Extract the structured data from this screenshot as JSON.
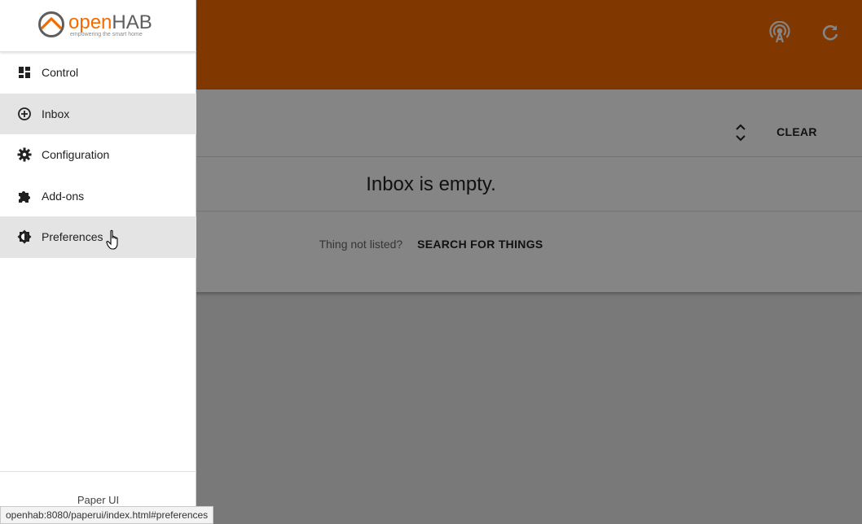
{
  "app": {
    "logo_name_open": "open",
    "logo_name_hab": "HAB",
    "logo_tagline": "empowering the smart home",
    "icons": [
      "antenna-icon",
      "refresh-icon"
    ]
  },
  "drawer": {
    "items": [
      {
        "label": "Control",
        "icon": "dashboard-icon"
      },
      {
        "label": "Inbox",
        "icon": "add-circle-icon"
      },
      {
        "label": "Configuration",
        "icon": "gear-icon"
      },
      {
        "label": "Add-ons",
        "icon": "puzzle-icon"
      },
      {
        "label": "Preferences",
        "icon": "brightness-icon"
      }
    ],
    "footer": "Paper UI"
  },
  "inbox": {
    "clear_label": "CLEAR",
    "empty_message": "Inbox is empty.",
    "hint": "Thing not listed?",
    "search_label": "SEARCH FOR THINGS"
  },
  "status_bar": "openhab:8080/paperui/index.html#preferences",
  "colors": {
    "accent": "#f56b00"
  }
}
